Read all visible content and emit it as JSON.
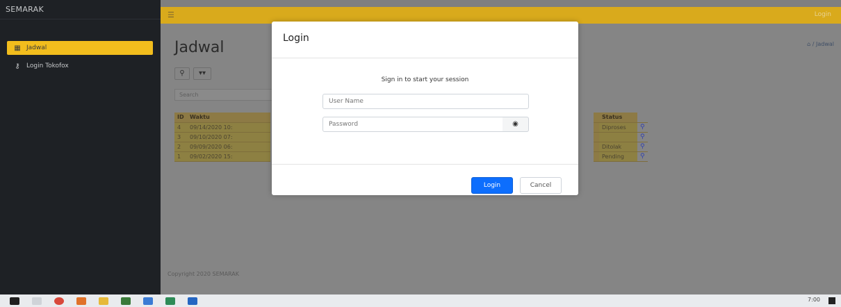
{
  "app": {
    "brand": "SEMARAK",
    "top_right": "Login"
  },
  "sidebar": {
    "items": [
      {
        "label": "Jadwal",
        "icon": "calendar-icon",
        "active": true
      },
      {
        "label": "Login Tokofox",
        "icon": "key-icon",
        "active": false
      }
    ]
  },
  "page": {
    "title": "Jadwal",
    "breadcrumb": "/ Jadwal",
    "search_placeholder": "Search",
    "footer": "Copyright 2020 SEMARAK"
  },
  "table": {
    "headers": [
      "ID",
      "Waktu"
    ],
    "rows": [
      [
        "4",
        "09/14/2020 10:"
      ],
      [
        "3",
        "09/10/2020 07:"
      ],
      [
        "2",
        "09/09/2020 06:"
      ],
      [
        "1",
        "09/02/2020 15:"
      ]
    ],
    "status_header": "Status",
    "status": [
      "Diproses",
      "",
      "Ditolak",
      "Pending"
    ]
  },
  "modal": {
    "title": "Login",
    "subtitle": "Sign in to start your session",
    "username_placeholder": "User Name",
    "password_placeholder": "Password",
    "login_label": "Login",
    "cancel_label": "Cancel"
  },
  "taskbar": {
    "clock": "7:00"
  },
  "colors": {
    "accent": "#f2bd1d",
    "primary": "#0d6efd",
    "sidebar": "#1e2125"
  }
}
